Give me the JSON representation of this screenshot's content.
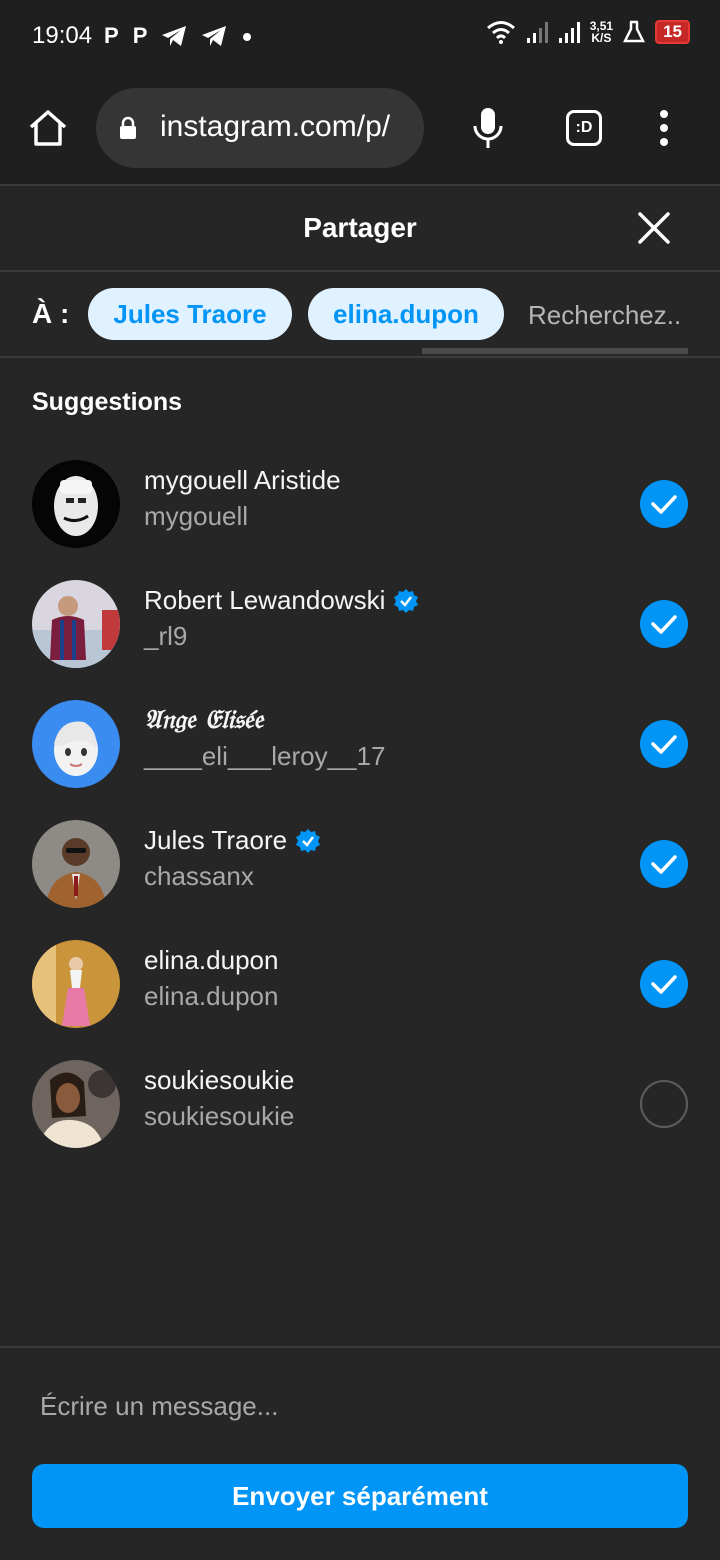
{
  "status_bar": {
    "time": "19:04",
    "left_icons": [
      "p-app-icon",
      "p-app-icon",
      "telegram-icon",
      "telegram-icon",
      "dot-icon"
    ],
    "left_glyphs": [
      "P",
      "P"
    ],
    "speed_value": "3,51",
    "speed_unit": "K/S",
    "battery": "15"
  },
  "browser": {
    "url": "instagram.com/p/",
    "tabs_label": ":D"
  },
  "share_sheet": {
    "title": "Partager",
    "to_label": "À :",
    "chips": [
      "Jules Traore",
      "elina.dupon"
    ],
    "search_placeholder": "Recherchez..",
    "suggestions_title": "Suggestions",
    "contacts": [
      {
        "name": "mygouell Aristide",
        "handle": "mygouell",
        "verified": false,
        "selected": true
      },
      {
        "name": "Robert Lewandowski",
        "handle": "_rl9",
        "verified": true,
        "selected": true
      },
      {
        "name": "𝔄𝔫𝔤𝔢 𝔈𝔩𝔦𝔰𝔢́𝔢",
        "handle": "____eli___leroy__17",
        "verified": false,
        "selected": true
      },
      {
        "name": "Jules Traore",
        "handle": "chassanx",
        "verified": true,
        "selected": true
      },
      {
        "name": "elina.dupon",
        "handle": "elina.dupon",
        "verified": false,
        "selected": true
      },
      {
        "name": "soukiesoukie",
        "handle": "soukiesoukie",
        "verified": false,
        "selected": false
      }
    ],
    "message_placeholder": "Écrire un message...",
    "send_label": "Envoyer séparément"
  },
  "colors": {
    "accent": "#0095f6",
    "background": "#262626",
    "chip_bg": "#e0f1ff"
  }
}
